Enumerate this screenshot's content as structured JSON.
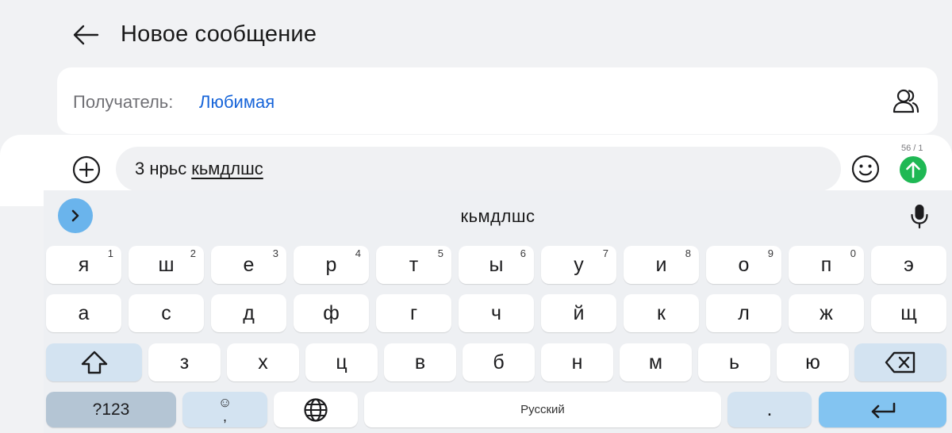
{
  "header": {
    "back_icon": "arrow-left-icon",
    "title": "Новое сообщение"
  },
  "recipient": {
    "label": "Получатель:",
    "value": "Любимая",
    "contacts_icon": "contacts-icon",
    "value_color": "#1664d9"
  },
  "compose": {
    "attach_icon": "plus-circle-icon",
    "text_plain": "3 нрьс",
    "text_underlined": "кьмдлшс",
    "emoji_icon": "smiley-icon",
    "counter": "56 / 1",
    "send_icon": "arrow-up-icon",
    "send_color": "#1fb854"
  },
  "keyboard": {
    "collapse_icon": "chevron-right-icon",
    "suggestion": "кьмдлшс",
    "mic_icon": "microphone-icon",
    "row1": [
      {
        "label": "я",
        "hint": "1"
      },
      {
        "label": "ш",
        "hint": "2"
      },
      {
        "label": "е",
        "hint": "3"
      },
      {
        "label": "р",
        "hint": "4"
      },
      {
        "label": "т",
        "hint": "5"
      },
      {
        "label": "ы",
        "hint": "6"
      },
      {
        "label": "у",
        "hint": "7"
      },
      {
        "label": "и",
        "hint": "8"
      },
      {
        "label": "о",
        "hint": "9"
      },
      {
        "label": "п",
        "hint": "0"
      },
      {
        "label": "э",
        "hint": ""
      }
    ],
    "row2": [
      "а",
      "с",
      "д",
      "ф",
      "г",
      "ч",
      "й",
      "к",
      "л",
      "ж",
      "щ"
    ],
    "row3": [
      "з",
      "х",
      "ц",
      "в",
      "б",
      "н",
      "м",
      "ь",
      "ю"
    ],
    "shift_icon": "shift-arrow-icon",
    "backspace_icon": "backspace-icon",
    "symbols_label": "?123",
    "emoji_key_top": "☺",
    "emoji_key_bottom": ",",
    "globe_icon": "globe-icon",
    "space_label": "Русский",
    "period_label": ".",
    "enter_icon": "enter-arrow-icon",
    "accent_color": "#83c4f1"
  }
}
